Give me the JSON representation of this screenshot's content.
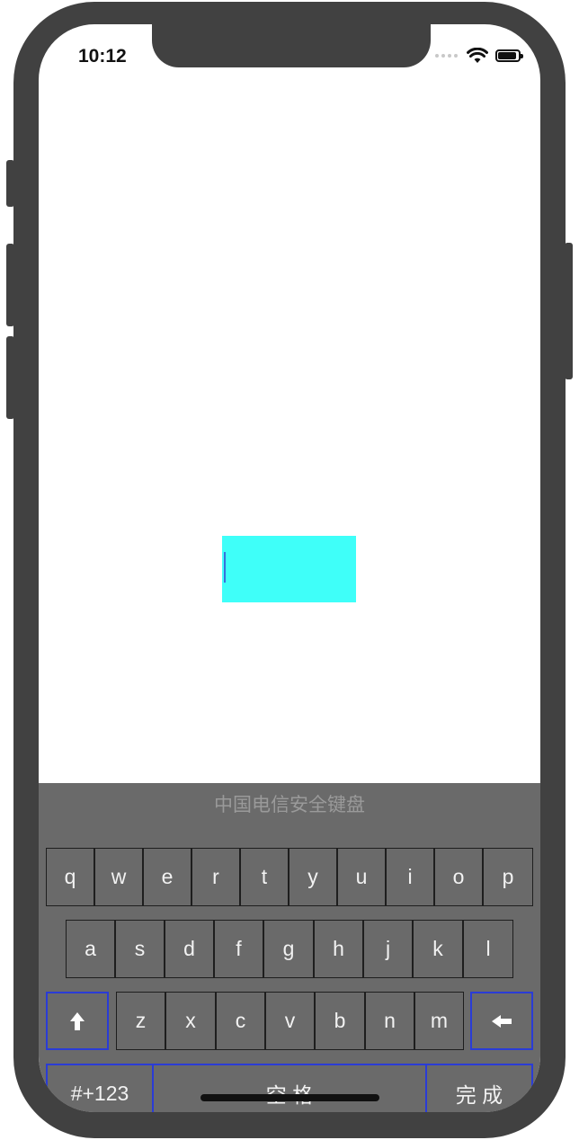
{
  "status_bar": {
    "time": "10:12"
  },
  "keyboard": {
    "title": "中国电信安全键盘",
    "row1": [
      "q",
      "w",
      "e",
      "r",
      "t",
      "y",
      "u",
      "i",
      "o",
      "p"
    ],
    "row2": [
      "a",
      "s",
      "d",
      "f",
      "g",
      "h",
      "j",
      "k",
      "l"
    ],
    "row3": [
      "z",
      "x",
      "c",
      "v",
      "b",
      "n",
      "m"
    ],
    "shift_icon": "up-arrow-icon",
    "backspace_icon": "left-arrow-icon",
    "symbols_label": "#+123",
    "space_label": "空 格",
    "done_label": "完 成"
  },
  "colors": {
    "text_field_bg": "#3ffff9",
    "keyboard_bg": "#6a6a6a",
    "key_blue_border": "#2a3cd6",
    "device_frame": "#414141"
  }
}
